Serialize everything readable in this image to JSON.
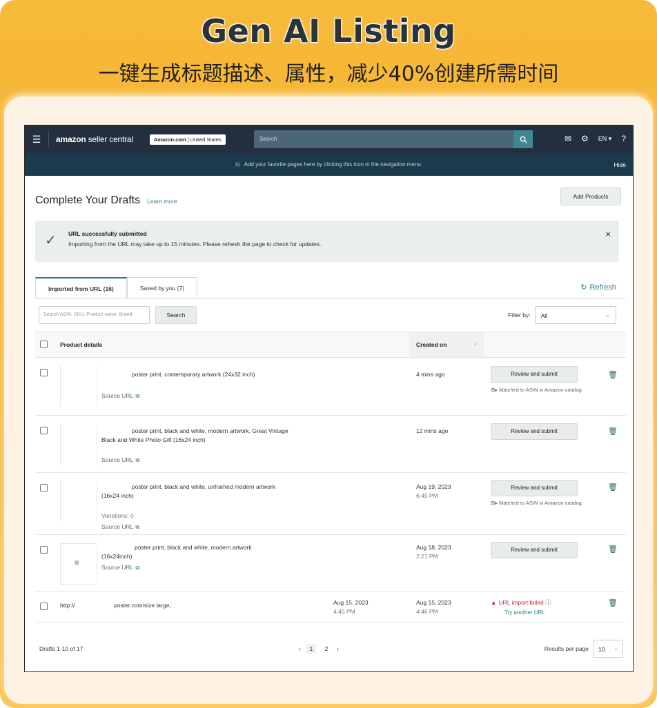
{
  "promo": {
    "title": "Gen AI Listing",
    "subtitle": "一键生成标题描述、属性，减少40%创建所需时间"
  },
  "navbar": {
    "logo_brand": "amazon",
    "logo_rest": " seller central",
    "marketplace_bold": "Amazon.com",
    "marketplace_rest": " | United States",
    "search_placeholder": "Search",
    "lang": "EN ▾",
    "icons": [
      "menu-icon",
      "search-icon",
      "mail-icon",
      "gear-icon",
      "help-icon"
    ]
  },
  "bookmark_bar": {
    "message": "Add your favorite pages here by clicking this icon in the navigation menu.",
    "hide": "Hide"
  },
  "page": {
    "title": "Complete Your Drafts",
    "learn_more": "Learn more",
    "add_products": "Add Products"
  },
  "alert": {
    "title": "URL successfully submitted",
    "message": "Importing from the URL may take up to 15 minutes. Please refresh the page to check for updates.",
    "close": "×"
  },
  "tabs": [
    {
      "label": "Imported from URL (16)",
      "active": true
    },
    {
      "label": "Saved by you (7)",
      "active": false
    }
  ],
  "refresh": "Refresh",
  "search": {
    "placeholder": "Search ASIN, SKU, Product name, Brand",
    "button": "Search"
  },
  "filter": {
    "label": "Filter by:",
    "value": "All"
  },
  "table": {
    "headers": {
      "product": "Product details",
      "created": "Created on",
      "sort_icon": "↓"
    },
    "rows": [
      {
        "title": "poster print, contemporary artwork (24x32 inch)",
        "link": "Source URL",
        "created": "4 mins ago",
        "action": "Review and submit",
        "matched_prefix": "Matched to ASIN in Amazon catalog"
      },
      {
        "title": "poster print, black and white, modern artwork, Great Vintage",
        "title2": "Black and White Photo Gift (16x24 inch)",
        "link": "Source URL",
        "created": "12 mins ago",
        "action": "Review and submit"
      },
      {
        "title": "poster print, black and white, unframed modern artwork",
        "title2": "(16x24 inch)",
        "variations": "Variations: 0",
        "link": "Source URL",
        "created": "Aug 19, 2023",
        "created_time": "6:45 PM",
        "action": "Review and submit",
        "matched_prefix": "Matched to ASIN in Amazon catalog"
      },
      {
        "title": "poster print, black and white, modern artwork",
        "title2": "(16x24inch)",
        "link": "Source URL",
        "created": "Aug 18, 2023",
        "created_time": "2:21 PM",
        "action": "Review and submit"
      },
      {
        "url_prefix": "http://",
        "url_rest": "poster.com/size large,",
        "submitted": "Aug 15, 2023",
        "submitted_time": "4:45 PM",
        "created": "Aug 15, 2023",
        "created_time": "4:46 PM",
        "fail": "URL import failed",
        "try": "Try another URL"
      }
    ]
  },
  "footer": {
    "drafts": "Drafts 1-10 of 17",
    "pages": [
      "1",
      "2"
    ],
    "prev": "‹",
    "next": "›",
    "rpp_label": "Results per page",
    "rpp_value": "10"
  },
  "colors": {
    "nav": "#232f3e",
    "bookmark": "#1b3a4b",
    "accent": "#2a7a8c",
    "promo": "#f7b93a",
    "error": "#c4283a"
  }
}
